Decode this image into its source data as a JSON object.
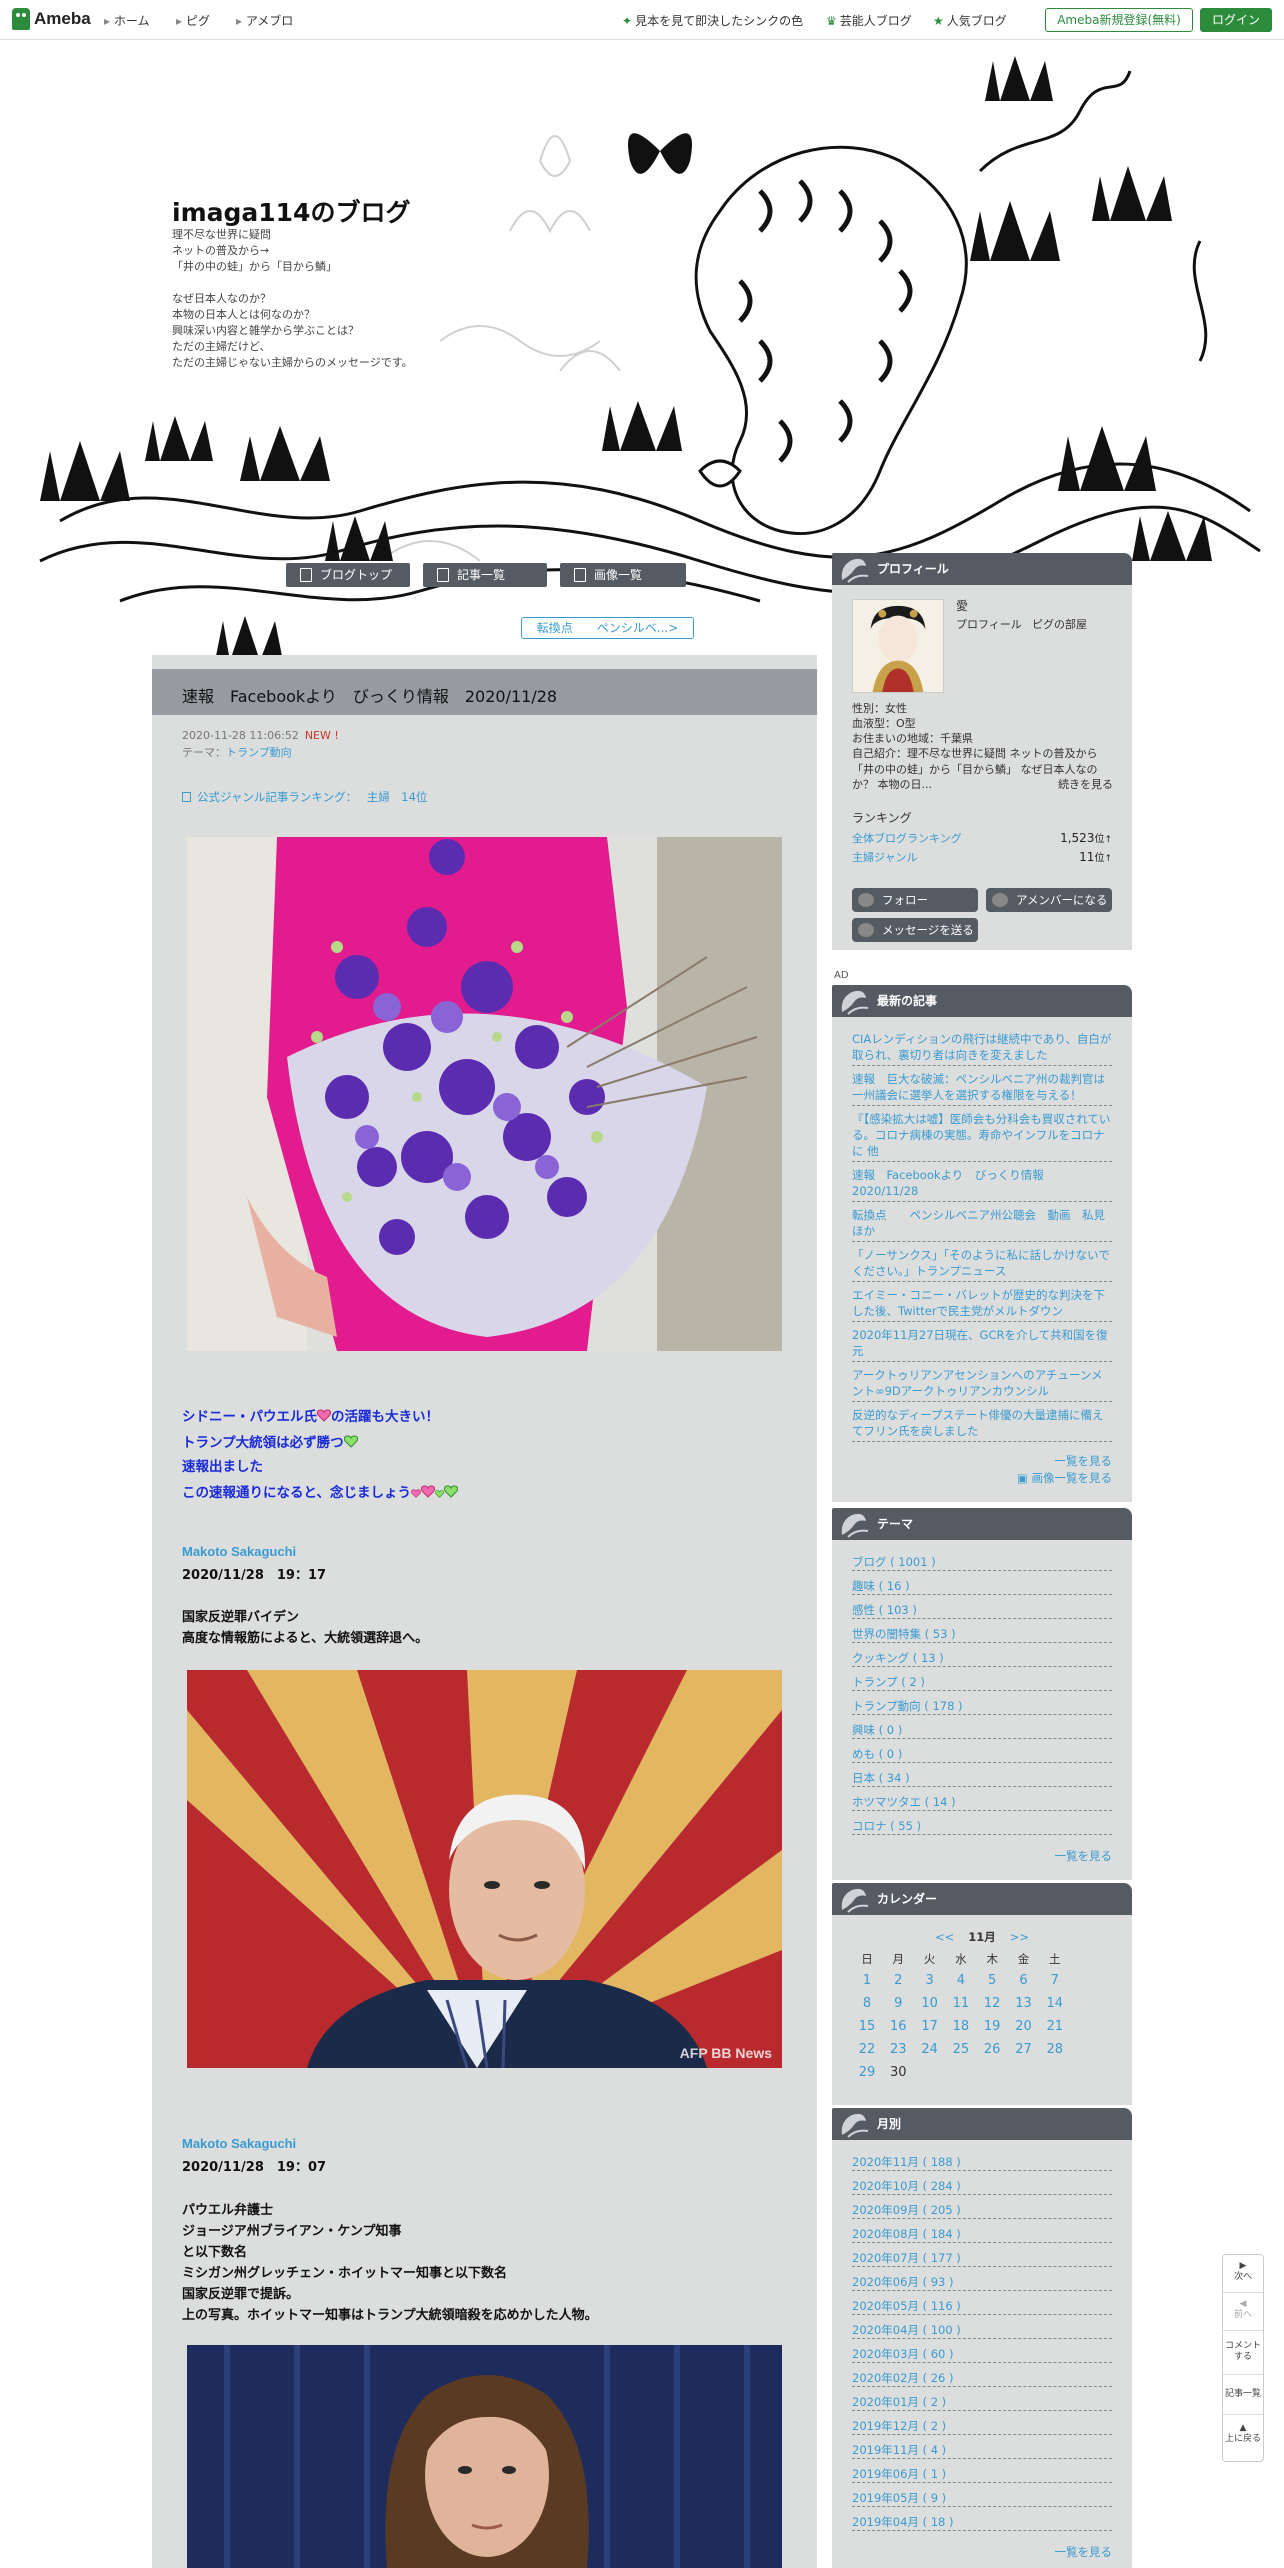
{
  "topbar": {
    "logo": "Ameba",
    "nav": [
      "ホーム",
      "ピグ",
      "アメブロ"
    ],
    "links": [
      "見本を見て即決したシンクの色",
      "芸能人ブログ",
      "人気ブログ"
    ],
    "register": "Ameba新規登録(無料)",
    "login": "ログイン"
  },
  "blog": {
    "title": "imaga114のブログ",
    "description": "理不尽な世界に疑問\nネットの普及から→\n「井の中の蛙」から「目から鱗」\n\nなぜ日本人なのか？\n本物の日本人とは何なのか？\n興味深い内容と雑学から学ぶことは？\nただの主婦だけど、\nただの主婦じゃない主婦からのメッセージです。"
  },
  "header_nav": {
    "top": "ブログトップ",
    "list": "記事一覧",
    "images": "画像一覧",
    "prev_article": "転換点　　ペンシルベ...>"
  },
  "article": {
    "title": "速報　Facebookより　びっくり情報　2020/11/28",
    "datetime": "2020-11-28 11:06:52",
    "new_badge": "NEW !",
    "theme_label": "テーマ：",
    "theme": "トランプ動向",
    "ranking_label": "公式ジャンル記事ランキング：",
    "ranking_value": "主婦　14位",
    "blue_lines": [
      "シドニー・パウエル氏",
      "の活躍も大きい！",
      "トランプ大統領は必ず勝つ",
      "速報出ました",
      "この速報通りになると、念じましょう"
    ],
    "section1": {
      "author": "Makoto Sakaguchi",
      "date": "2020/11/28　19：17",
      "text": "国家反逆罪バイデン\n高度な情報筋によると、大統領選辞退へ。"
    },
    "photo_credit": "AFP BB News",
    "section2": {
      "author": "Makoto Sakaguchi",
      "date": "2020/11/28　19：07",
      "text": "パウエル弁護士\nジョージア州ブライアン・ケンプ知事\nと以下数名\nミシガン州グレッチェン・ホイットマー知事と以下数名\n国家反逆罪で提訴。\n上の写真。ホイットマー知事はトランプ大統領暗殺を応めかした人物。"
    }
  },
  "profile": {
    "heading": "プロフィール",
    "name": "愛",
    "links": [
      "プロフィール",
      "ピグの部屋"
    ],
    "gender": "性別：女性",
    "blood": "血液型：O型",
    "residence": "お住まいの地域：千葉県",
    "intro": "自己紹介：理不尽な世界に疑問 ネットの普及から「井の中の蛙」から「目から鱗」 なぜ日本人なのか？ 本物の日...",
    "more": "続きを見る",
    "ranking_title": "ランキング",
    "rank_overall_label": "全体ブログランキング",
    "rank_overall_value": "1,523",
    "rank_genre_label": "主婦ジャンル",
    "rank_genre_value": "11",
    "rank_unit": "位",
    "follow": "フォロー",
    "amember": "アメンバーになる",
    "message": "メッセージを送る"
  },
  "ad_label": "AD",
  "recent": {
    "heading": "最新の記事",
    "items": [
      "CIAレンディションの飛行は継続中であり、自白が取られ、裏切り者は向きを変えました",
      "速報　巨大な破滅：ペンシルベニア州の裁判官は一州議会に選挙人を選択する権限を与える！",
      "『【感染拡大は嘘】医師会も分科会も買収されている。コロナ病棟の実態。寿命やインフルをコロナに 他",
      "速報　Facebookより　びっくり情報 2020/11/28",
      "転換点　　ペンシルベニア州公聴会　動画　私見ほか",
      "「ノーサンクス」「そのように私に話しかけないでください。」トランプニュース",
      "エイミー・コニー・バレットが歴史的な判決を下した後、Twitterで民主党がメルトダウン",
      "2020年11月27日現在、GCRを介して共和国を復元",
      "アークトゥリアンアセンションへのアチューンメント∞9Dアークトゥリアンカウンシル",
      "反逆的なディープステート俳優の大量逮捕に備えてフリン氏を戻しました"
    ],
    "more": "一覧を見る",
    "images": "画像一覧を見る"
  },
  "themes": {
    "heading": "テーマ",
    "items": [
      "ブログ ( 1001 )",
      "趣味 ( 16 )",
      "感性 ( 103 )",
      "世界の闇特集 ( 53 )",
      "クッキング ( 13 )",
      "トランプ ( 2 )",
      "トランプ動向 ( 178 )",
      "興味 ( 0 )",
      "めも ( 0 )",
      "日本 ( 34 )",
      "ホツマツタエ ( 14 )",
      "コロナ ( 55 )"
    ],
    "more": "一覧を見る"
  },
  "calendar": {
    "heading": "カレンダー",
    "prev": "<<",
    "month": "11月",
    "next": ">>",
    "weekdays": [
      "日",
      "月",
      "火",
      "水",
      "木",
      "金",
      "土"
    ],
    "weeks": [
      [
        "1",
        "2",
        "3",
        "4",
        "5",
        "6",
        "7"
      ],
      [
        "8",
        "9",
        "10",
        "11",
        "12",
        "13",
        "14"
      ],
      [
        "15",
        "16",
        "17",
        "18",
        "19",
        "20",
        "21"
      ],
      [
        "22",
        "23",
        "24",
        "25",
        "26",
        "27",
        "28"
      ],
      [
        "29",
        "30",
        "",
        "",
        "",
        "",
        ""
      ]
    ]
  },
  "archive": {
    "heading": "月別",
    "items": [
      "2020年11月 ( 188 )",
      "2020年10月 ( 284 )",
      "2020年09月 ( 205 )",
      "2020年08月 ( 184 )",
      "2020年07月 ( 177 )",
      "2020年06月 ( 93 )",
      "2020年05月 ( 116 )",
      "2020年04月 ( 100 )",
      "2020年03月 ( 60 )",
      "2020年02月 ( 26 )",
      "2020年01月 ( 2 )",
      "2019年12月 ( 2 )",
      "2019年11月 ( 4 )",
      "2019年06月 ( 1 )",
      "2019年05月 ( 9 )",
      "2019年04月 ( 18 )"
    ],
    "more": "一覧を見る"
  },
  "float_nav": {
    "next": "次へ",
    "prev": "前へ",
    "comment": "コメントする",
    "list": "記事一覧",
    "top": "上に戻る"
  },
  "colors": {
    "ameba_green": "#2d8c3c",
    "link_blue": "#3a9bd1",
    "article_blue": "#1a2bd8",
    "panel_gray": "#dcdddd",
    "header_gray": "#555b63"
  }
}
